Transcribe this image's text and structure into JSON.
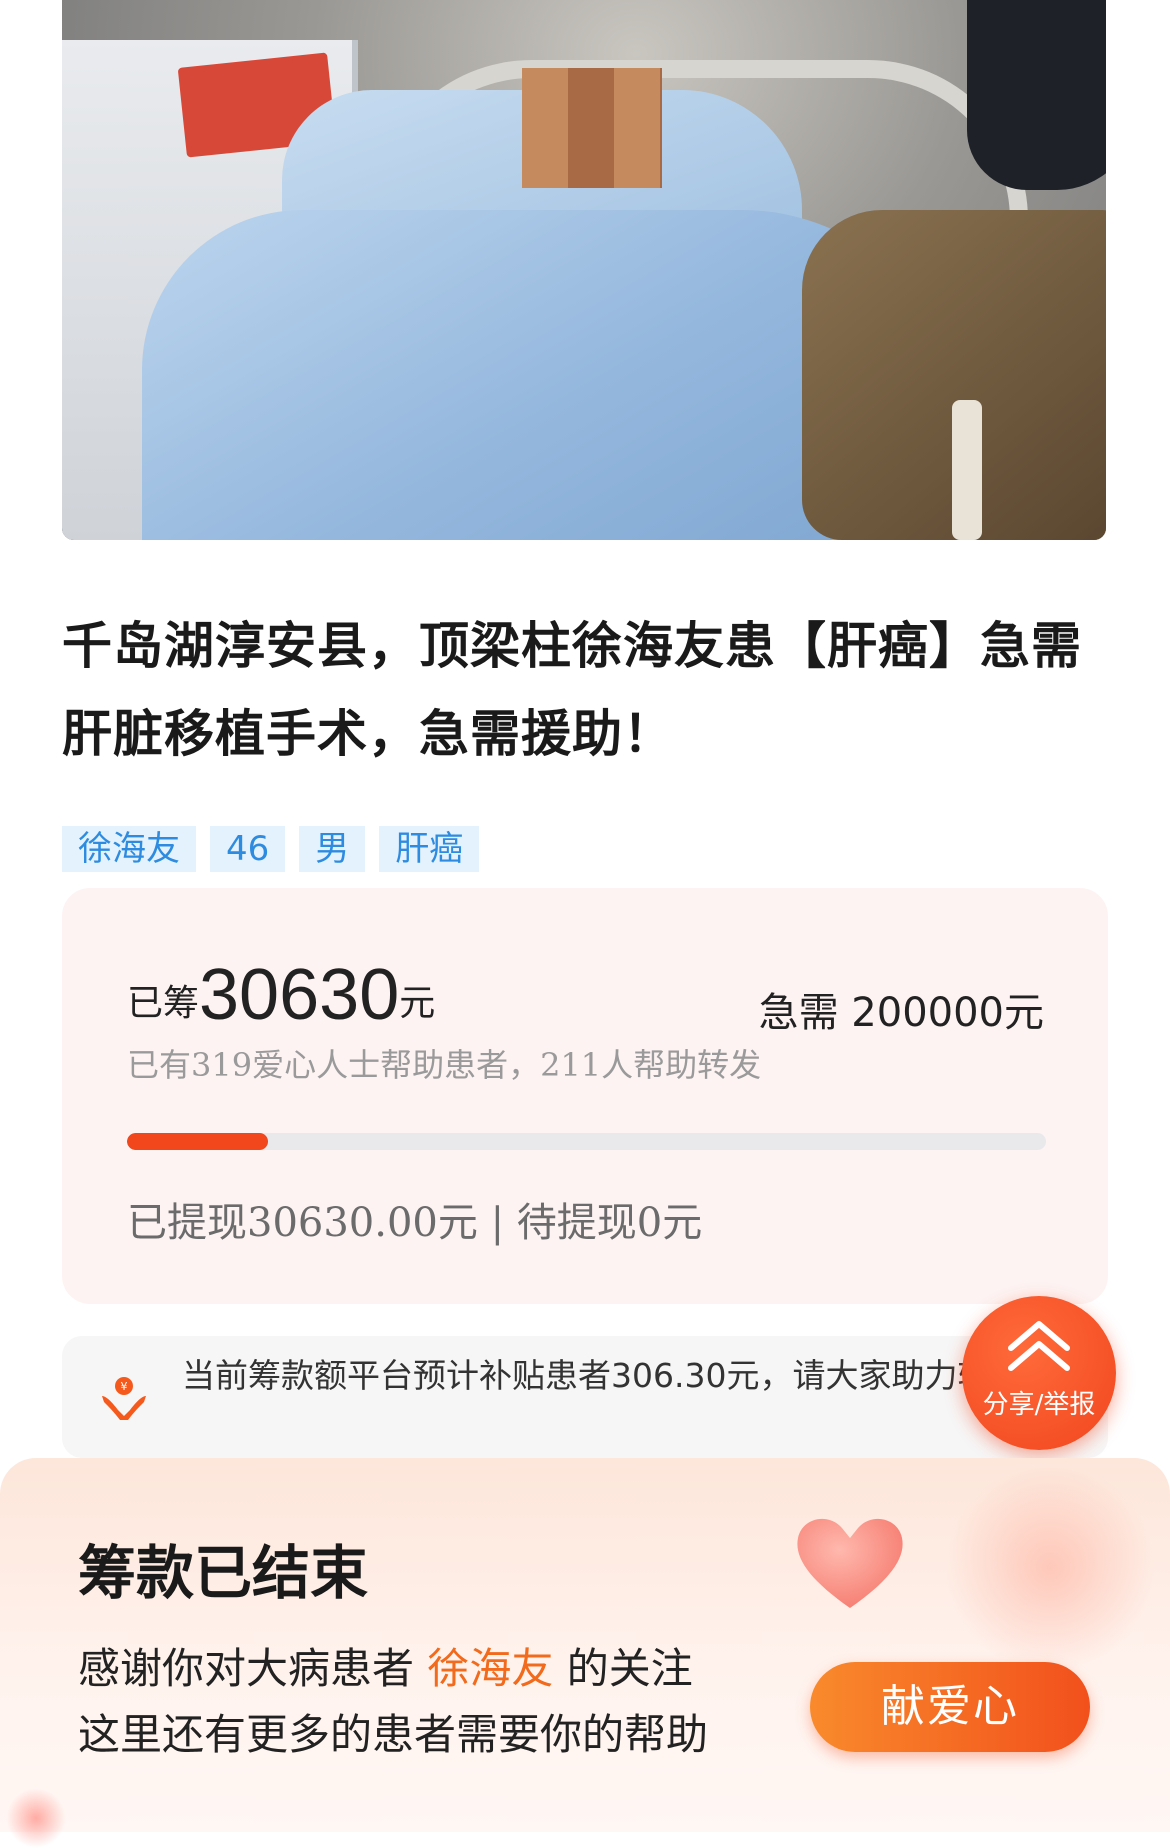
{
  "hero": {
    "image_alt": "patient-photo"
  },
  "title": "千岛湖淳安县，顶梁柱徐海友患【肝癌】急需肝脏移植手术，急需援助！",
  "tags": [
    "徐海友",
    "46",
    "男",
    "肝癌"
  ],
  "funding": {
    "raised_prefix": "已筹",
    "raised_amount": "30630",
    "raised_unit": "元",
    "need_text": "急需 200000元",
    "donors_text": "已有319爱心人士帮助患者，211人帮助转发",
    "progress_fraction": 0.153,
    "withdraw_text": "已提现30630.00元 | 待提现0元"
  },
  "notice": {
    "icon": "helping-hands-icon",
    "text": "当前筹款额平台预计补贴患者306.30元，请大家助力转发！"
  },
  "fab": {
    "label": "分享/举报",
    "icon": "chevron-up-icon"
  },
  "ended": {
    "heading": "筹款已结束",
    "thanks_prefix": "感谢你对大病患者 ",
    "patient_name": "徐海友",
    "thanks_suffix": " 的关注",
    "more_text": "这里还有更多的患者需要你的帮助",
    "donate_button": "献爱心"
  },
  "colors": {
    "accent": "#f2461d",
    "tag_bg": "#e4f2fd",
    "tag_text": "#2e8ce0",
    "name_highlight": "#f26a1b"
  }
}
